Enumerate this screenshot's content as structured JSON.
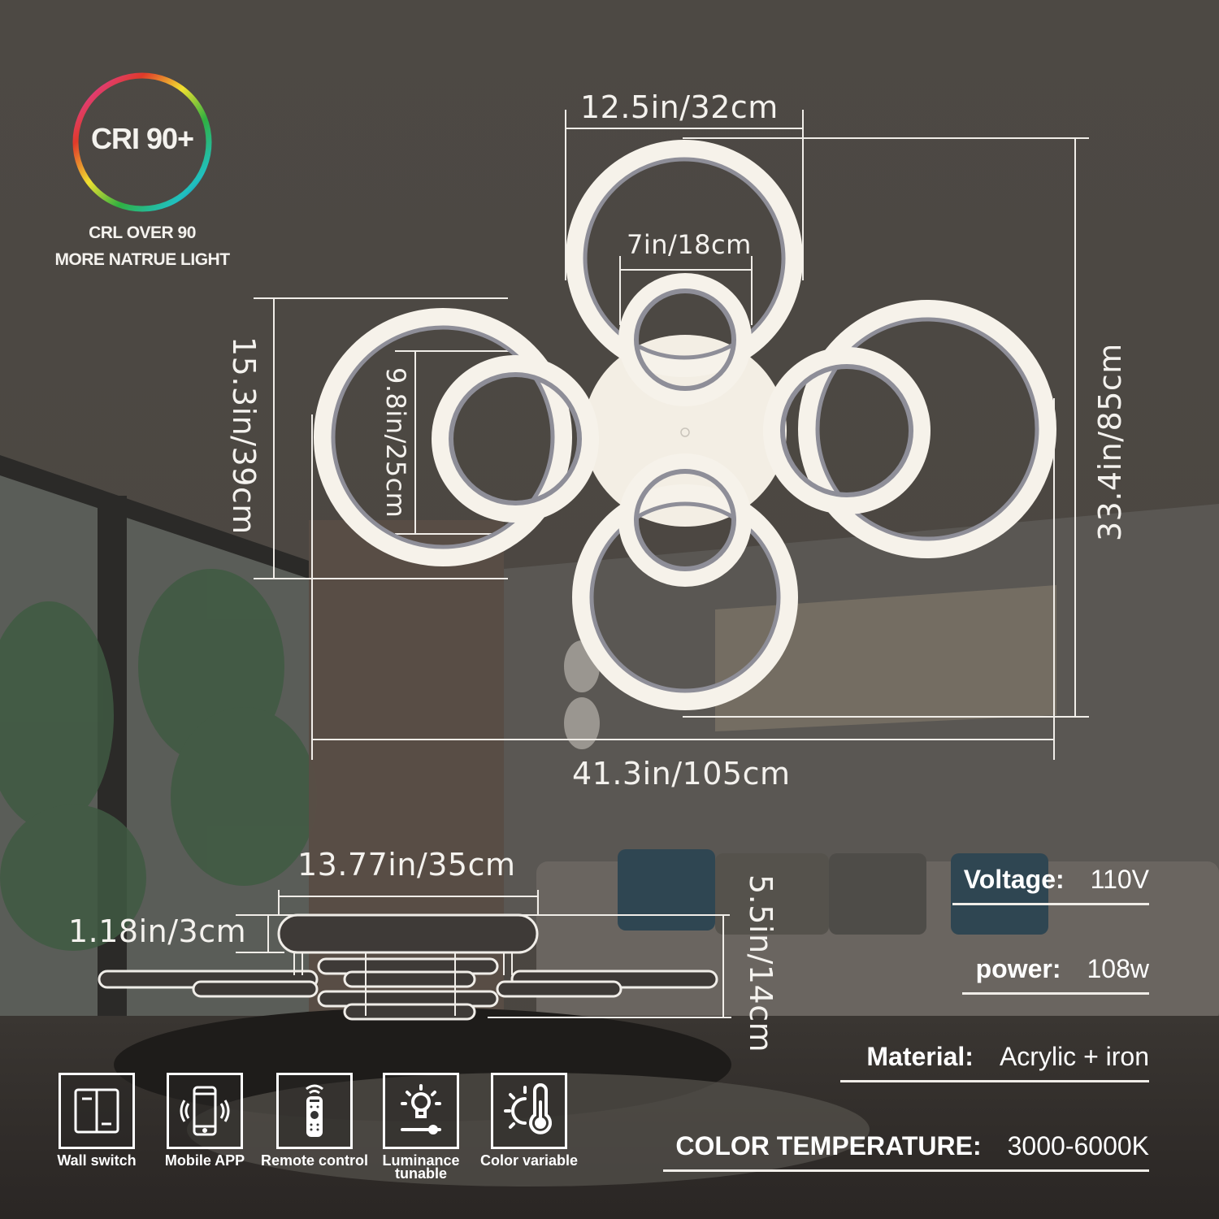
{
  "badge": {
    "title": "CRI 90+",
    "line1": "CRL OVER 90",
    "line2": "MORE NATRUE LIGHT"
  },
  "dimensions": {
    "ring_width": "12.5in/32cm",
    "inner_ring_width": "7in/18cm",
    "arm_height": "15.3in/39cm",
    "inner_ring_height": "9.8in/25cm",
    "total_height": "33.4in/85cm",
    "total_width": "41.3in/105cm",
    "base_width": "13.77in/35cm",
    "base_thickness": "1.18in/3cm",
    "side_height": "5.5in/14cm"
  },
  "specs": [
    {
      "key": "Voltage:",
      "value": "110V"
    },
    {
      "key": "power:",
      "value": "108w"
    },
    {
      "key": "Material:",
      "value": "Acrylic + iron"
    },
    {
      "key": "COLOR TEMPERATURE:",
      "value": "3000-6000K"
    }
  ],
  "features": [
    {
      "icon": "wall-switch-icon",
      "label": "Wall switch"
    },
    {
      "icon": "mobile-app-icon",
      "label": "Mobile APP"
    },
    {
      "icon": "remote-control-icon",
      "label": "Remote control"
    },
    {
      "icon": "luminance-icon",
      "label": "Luminance tunable"
    },
    {
      "icon": "color-temperature-icon",
      "label": "Color variable"
    }
  ],
  "colors": {
    "background": "#4a4641",
    "ring": "#f6f2ea",
    "ring_inner": "#8e8e98",
    "line": "#f0ede8"
  }
}
